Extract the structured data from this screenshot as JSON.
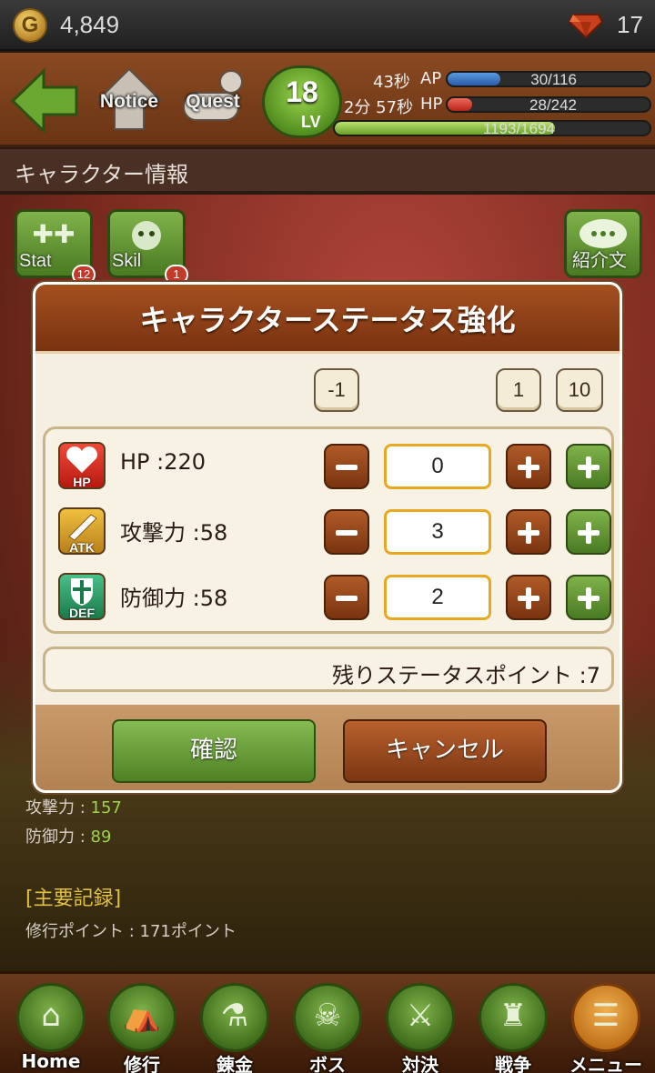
{
  "topbar": {
    "coin_symbol": "G",
    "gold": "4,849",
    "gems": "17"
  },
  "status": {
    "nav_notice": "Notice",
    "nav_quest": "Quest",
    "level": "18",
    "level_label": "LV",
    "ap_timer": "43秒",
    "ap_label": "AP",
    "ap_value": "30/116",
    "ap_fraction": 0.26,
    "hp_timer": "2分 57秒",
    "hp_label": "HP",
    "hp_value": "28/242",
    "hp_fraction": 0.12,
    "exp_value": "1193/1694",
    "exp_fraction": 0.7
  },
  "section_title": "キャラクター情報",
  "side_buttons": [
    {
      "label": "Stat",
      "badge": "12"
    },
    {
      "label": "Skil",
      "badge": "1"
    },
    {
      "label": "紹介文"
    }
  ],
  "background": {
    "attack_label": "攻撃力 : ",
    "attack_value": "157",
    "defense_label": "防御力 : ",
    "defense_value": "89",
    "records_heading": "[主要記録]",
    "training_points": "修行ポイント : 171ポイント"
  },
  "modal": {
    "title": "キャラクターステータス強化",
    "step_minus": "-1",
    "step_plus1": "1",
    "step_plus10": "10",
    "rows": [
      {
        "icon": "heart-icon",
        "icon_label": "HP",
        "label": "HP :220",
        "value": "0"
      },
      {
        "icon": "sword-icon",
        "icon_label": "ATK",
        "label": "攻撃力 :58",
        "value": "3"
      },
      {
        "icon": "shield-icon",
        "icon_label": "DEF",
        "label": "防御力 :58",
        "value": "2"
      }
    ],
    "remaining": "残りステータスポイント :7",
    "confirm": "確認",
    "cancel": "キャンセル"
  },
  "bottom_nav": [
    {
      "label": "Home",
      "icon": "home-icon",
      "glyph": "⌂"
    },
    {
      "label": "修行",
      "icon": "tent-icon",
      "glyph": "⛺"
    },
    {
      "label": "錬金",
      "icon": "pot-icon",
      "glyph": "⚗"
    },
    {
      "label": "ボス",
      "icon": "dragon-icon",
      "glyph": "☠"
    },
    {
      "label": "対決",
      "icon": "swords-icon",
      "glyph": "⚔"
    },
    {
      "label": "戦争",
      "icon": "castle-icon",
      "glyph": "♜"
    },
    {
      "label": "メニュー",
      "icon": "menu-icon",
      "glyph": "☰"
    }
  ],
  "colors": {
    "accent_green": "#4e8224",
    "accent_brown": "#7a3410",
    "field_border": "#e8a820"
  }
}
